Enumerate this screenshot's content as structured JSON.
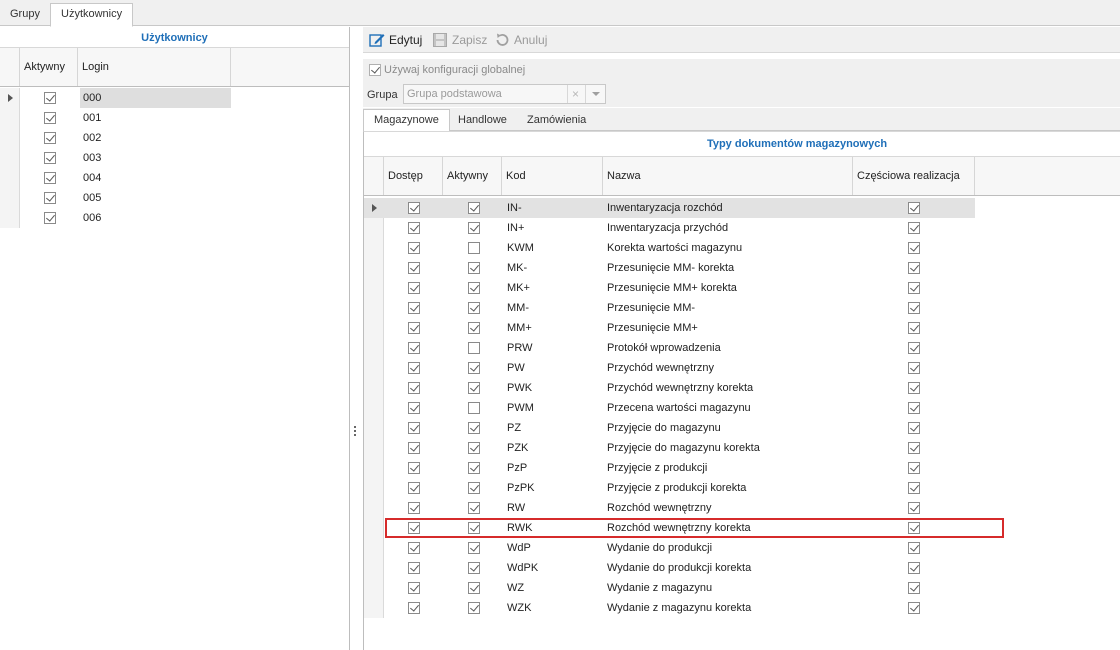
{
  "top_tabs": [
    {
      "label": "Grupy",
      "active": false
    },
    {
      "label": "Użytkownicy",
      "active": true
    }
  ],
  "users_grid": {
    "title": "Użytkownicy",
    "columns": {
      "active": "Aktywny",
      "login": "Login"
    },
    "rows": [
      {
        "active": true,
        "login": "000",
        "selected": true
      },
      {
        "active": true,
        "login": "001"
      },
      {
        "active": true,
        "login": "002"
      },
      {
        "active": true,
        "login": "003"
      },
      {
        "active": true,
        "login": "004"
      },
      {
        "active": true,
        "login": "005"
      },
      {
        "active": true,
        "login": "006"
      }
    ]
  },
  "toolbar": {
    "edit_label": "Edytuj",
    "save_label": "Zapisz",
    "cancel_label": "Anuluj",
    "accent": "#1f6fb8"
  },
  "config": {
    "use_global_label": "Używaj konfiguracji globalnej",
    "use_global_checked": true,
    "group_label": "Grupa",
    "group_value": "Grupa podstawowa"
  },
  "sub_tabs": [
    {
      "label": "Magazynowe",
      "active": true
    },
    {
      "label": "Handlowe",
      "active": false
    },
    {
      "label": "Zamówienia",
      "active": false
    }
  ],
  "doc_types_grid": {
    "title": "Typy dokumentów magazynowych",
    "columns": {
      "access": "Dostęp",
      "active": "Aktywny",
      "code": "Kod",
      "name": "Nazwa",
      "partial": "Częściowa realizacja"
    },
    "highlight_color": "#d62b2b",
    "rows": [
      {
        "access": true,
        "active": true,
        "code": "IN-",
        "name": "Inwentaryzacja rozchód",
        "partial": true,
        "selected": true
      },
      {
        "access": true,
        "active": true,
        "code": "IN+",
        "name": "Inwentaryzacja przychód",
        "partial": true
      },
      {
        "access": true,
        "active": false,
        "code": "KWM",
        "name": "Korekta wartości magazynu",
        "partial": true
      },
      {
        "access": true,
        "active": true,
        "code": "MK-",
        "name": "Przesunięcie MM- korekta",
        "partial": true
      },
      {
        "access": true,
        "active": true,
        "code": "MK+",
        "name": "Przesunięcie MM+ korekta",
        "partial": true
      },
      {
        "access": true,
        "active": true,
        "code": "MM-",
        "name": "Przesunięcie MM-",
        "partial": true
      },
      {
        "access": true,
        "active": true,
        "code": "MM+",
        "name": "Przesunięcie MM+",
        "partial": true
      },
      {
        "access": true,
        "active": false,
        "code": "PRW",
        "name": "Protokół wprowadzenia",
        "partial": true
      },
      {
        "access": true,
        "active": true,
        "code": "PW",
        "name": "Przychód wewnętrzny",
        "partial": true
      },
      {
        "access": true,
        "active": true,
        "code": "PWK",
        "name": "Przychód wewnętrzny korekta",
        "partial": true
      },
      {
        "access": true,
        "active": false,
        "code": "PWM",
        "name": "Przecena wartości magazynu",
        "partial": true
      },
      {
        "access": true,
        "active": true,
        "code": "PZ",
        "name": "Przyjęcie do magazynu",
        "partial": true
      },
      {
        "access": true,
        "active": true,
        "code": "PZK",
        "name": "Przyjęcie do magazynu korekta",
        "partial": true
      },
      {
        "access": true,
        "active": true,
        "code": "PzP",
        "name": "Przyjęcie z produkcji",
        "partial": true
      },
      {
        "access": true,
        "active": true,
        "code": "PzPK",
        "name": "Przyjęcie z produkcji korekta",
        "partial": true
      },
      {
        "access": true,
        "active": true,
        "code": "RW",
        "name": "Rozchód wewnętrzny",
        "partial": true
      },
      {
        "access": true,
        "active": true,
        "code": "RWK",
        "name": "Rozchód wewnętrzny korekta",
        "partial": true,
        "highlighted": true
      },
      {
        "access": true,
        "active": true,
        "code": "WdP",
        "name": "Wydanie do produkcji",
        "partial": true
      },
      {
        "access": true,
        "active": true,
        "code": "WdPK",
        "name": "Wydanie do produkcji korekta",
        "partial": true
      },
      {
        "access": true,
        "active": true,
        "code": "WZ",
        "name": "Wydanie z magazynu",
        "partial": true
      },
      {
        "access": true,
        "active": true,
        "code": "WZK",
        "name": "Wydanie z magazynu korekta",
        "partial": true
      }
    ]
  }
}
